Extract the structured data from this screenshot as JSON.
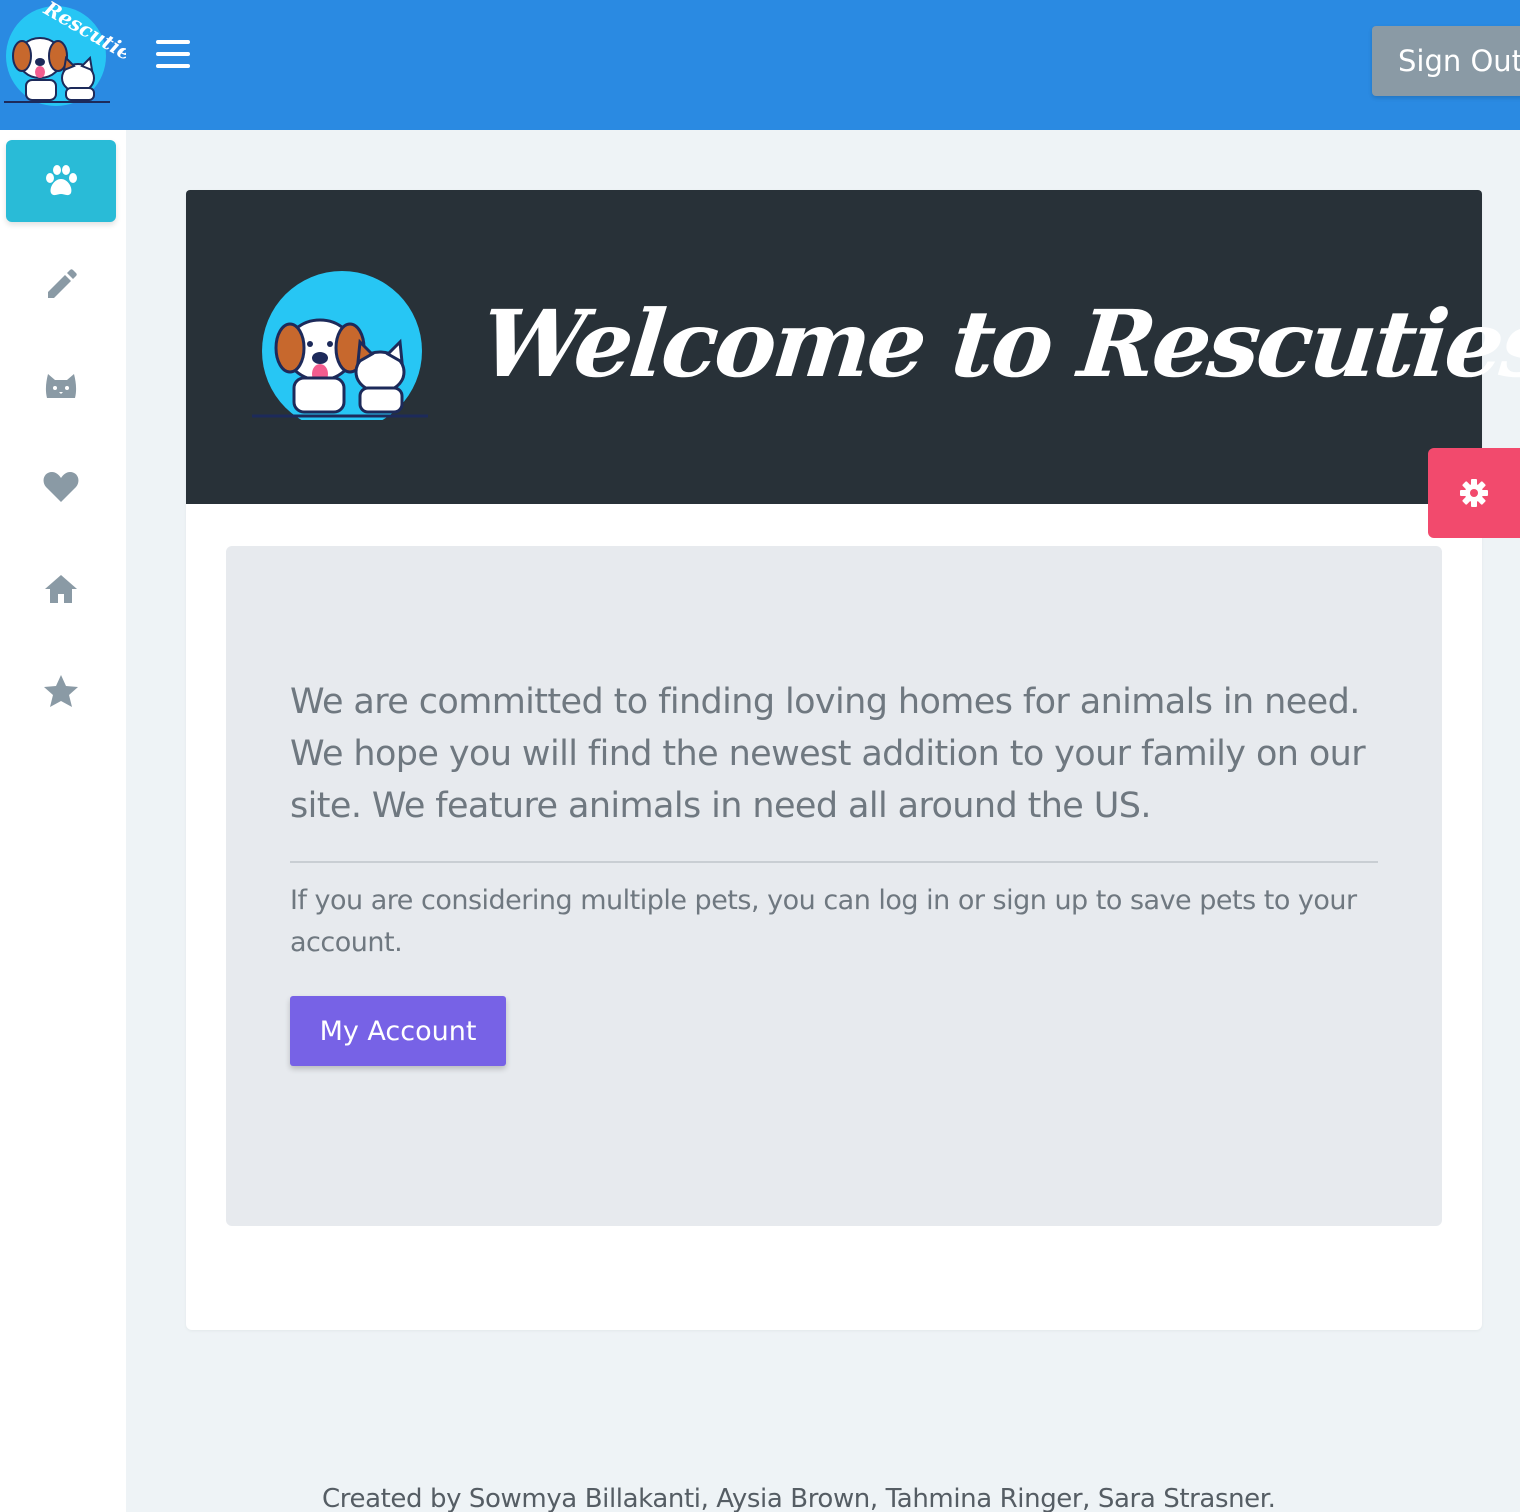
{
  "header": {
    "logo_text": "Rescuties",
    "menu_icon": "hamburger-menu-icon",
    "sign_out_label": "Sign Out"
  },
  "sidebar": {
    "items": [
      {
        "icon": "paw-icon",
        "active": true
      },
      {
        "icon": "pencil-icon",
        "active": false
      },
      {
        "icon": "cat-icon",
        "active": false
      },
      {
        "icon": "heart-icon",
        "active": false
      },
      {
        "icon": "home-icon",
        "active": false
      },
      {
        "icon": "star-icon",
        "active": false
      }
    ]
  },
  "hero": {
    "title": "Welcome to Rescuties"
  },
  "content": {
    "lead": "We are committed to finding loving homes for animals in need. We hope you will find the newest addition to your family on our site. We feature animals in need all around the US.",
    "sub": "If you are considering multiple pets, you can log in or sign up to save pets to your account.",
    "account_button": "My Account"
  },
  "settings": {
    "icon": "gear-icon"
  },
  "footer": {
    "credits": "Created by Sowmya Billakanti, Aysia Brown, Tahmina Ringer, Sara Strasner."
  },
  "colors": {
    "topbar": "#2a8ae2",
    "sidebar_active": "#29bbd7",
    "hero_bg": "#283138",
    "primary_button": "#7762e6",
    "settings_button": "#f24a6d"
  }
}
